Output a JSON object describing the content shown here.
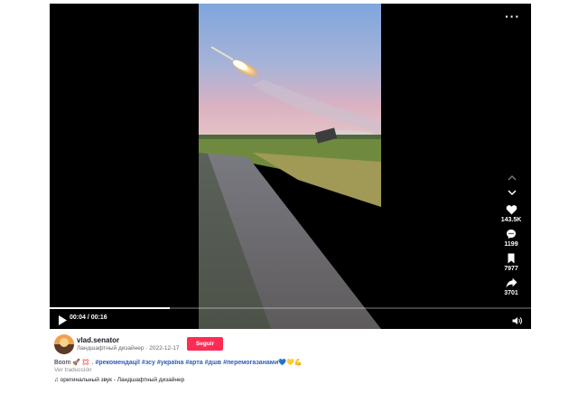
{
  "player": {
    "more_label": "···",
    "time": "00:04 / 00:16",
    "progress_fraction": 0.25,
    "play_icon": "play-icon",
    "volume_icon": "volume-icon"
  },
  "rail": {
    "likes": "143.5K",
    "comments": "1199",
    "saves": "7977",
    "shares": "3701"
  },
  "author": {
    "username": "vlad.senator",
    "subtitle": "Ландшафтный дизайнер · 2022-12-17",
    "follow_label": "Seguir"
  },
  "caption": {
    "text": "Boom 🚀 💢 .",
    "hashtags": [
      "#рекомендації",
      "#зсу",
      "#україна",
      "#арта",
      "#дшв",
      "#перемогазанами"
    ],
    "emoji_suffix": "💙💛💪",
    "translate_label": "Ver traducción"
  },
  "sound": {
    "label": "♫ оригинальный звук - Ландшафтный дизайнер"
  },
  "colors": {
    "accent": "#fe2c55",
    "hashtag": "#2b5db9"
  }
}
